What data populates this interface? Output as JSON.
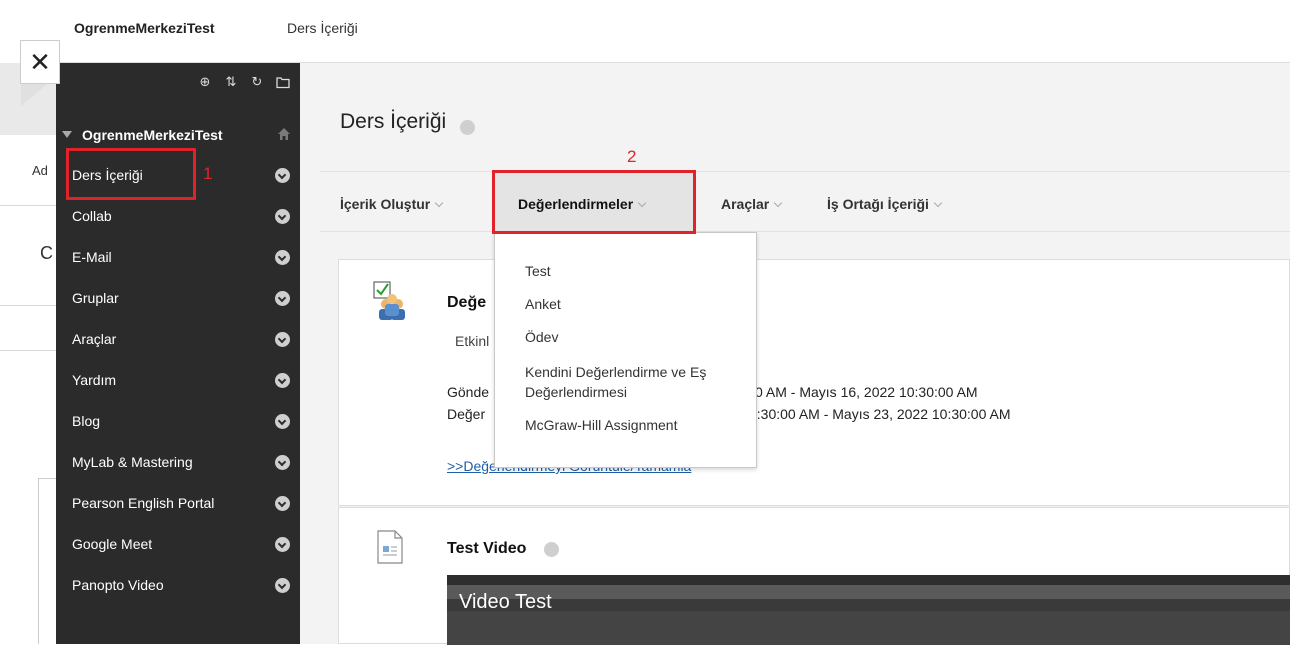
{
  "topbar": {
    "brand": "OgrenmeMerkeziTest",
    "crumb": "Ders İçeriği"
  },
  "background_fragments": {
    "frag_a": "Ad",
    "frag_c": "C"
  },
  "sidebar": {
    "course_title": "OgrenmeMerkeziTest",
    "items": [
      {
        "label": "Ders İçeriği"
      },
      {
        "label": "Collab"
      },
      {
        "label": "E-Mail"
      },
      {
        "label": "Gruplar"
      },
      {
        "label": "Araçlar"
      },
      {
        "label": "Yardım"
      },
      {
        "label": "Blog"
      },
      {
        "label": "MyLab & Mastering"
      },
      {
        "label": "Pearson English Portal"
      },
      {
        "label": "Google Meet"
      },
      {
        "label": "Panopto Video"
      }
    ]
  },
  "main": {
    "title": "Ders İçeriği",
    "menu": [
      {
        "label": "İçerik Oluştur"
      },
      {
        "label": "Değerlendirmeler"
      },
      {
        "label": "Araçlar"
      },
      {
        "label": "İş Ortağı İçeriği"
      }
    ]
  },
  "dropdown": {
    "items": [
      {
        "label": "Test"
      },
      {
        "label": "Anket"
      },
      {
        "label": "Ödev"
      },
      {
        "label": "Kendini Değerlendirme ve Eş Değerlendirmesi"
      },
      {
        "label": "McGraw-Hill Assignment"
      }
    ]
  },
  "card1": {
    "title": "Değe",
    "line1": "Etkinl",
    "line2_left": "Gönde",
    "line2_right": "0 AM - Mayıs 16, 2022 10:30:00 AM",
    "line3_left": "Değer",
    "line3_right": "0:30:00 AM - Mayıs 23, 2022 10:30:00 AM",
    "link": ">>Değerlendirmeyi Görüntüle/Tamamla"
  },
  "card2": {
    "title": "Test Video",
    "video_label": "Video Test"
  },
  "annotations": {
    "n1": "1",
    "n2": "2"
  },
  "colors": {
    "sidebar": "#2b2b2b",
    "annotation_red": "#e0232b",
    "link": "#1f5fa8"
  }
}
